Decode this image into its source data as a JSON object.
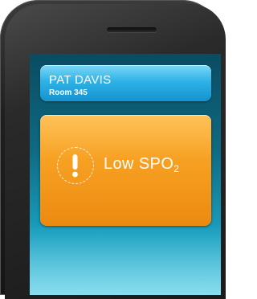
{
  "patient": {
    "name": "PAT DAVIS",
    "room": "Room 345"
  },
  "alert": {
    "icon": "exclamation-icon",
    "text_main": "Low SPO",
    "text_subscript": "2",
    "color": "#f7a123"
  },
  "colors": {
    "patient_card": "#2eb2e6",
    "screen": "#0e6a83",
    "phone_body": "#1f1f1f"
  }
}
